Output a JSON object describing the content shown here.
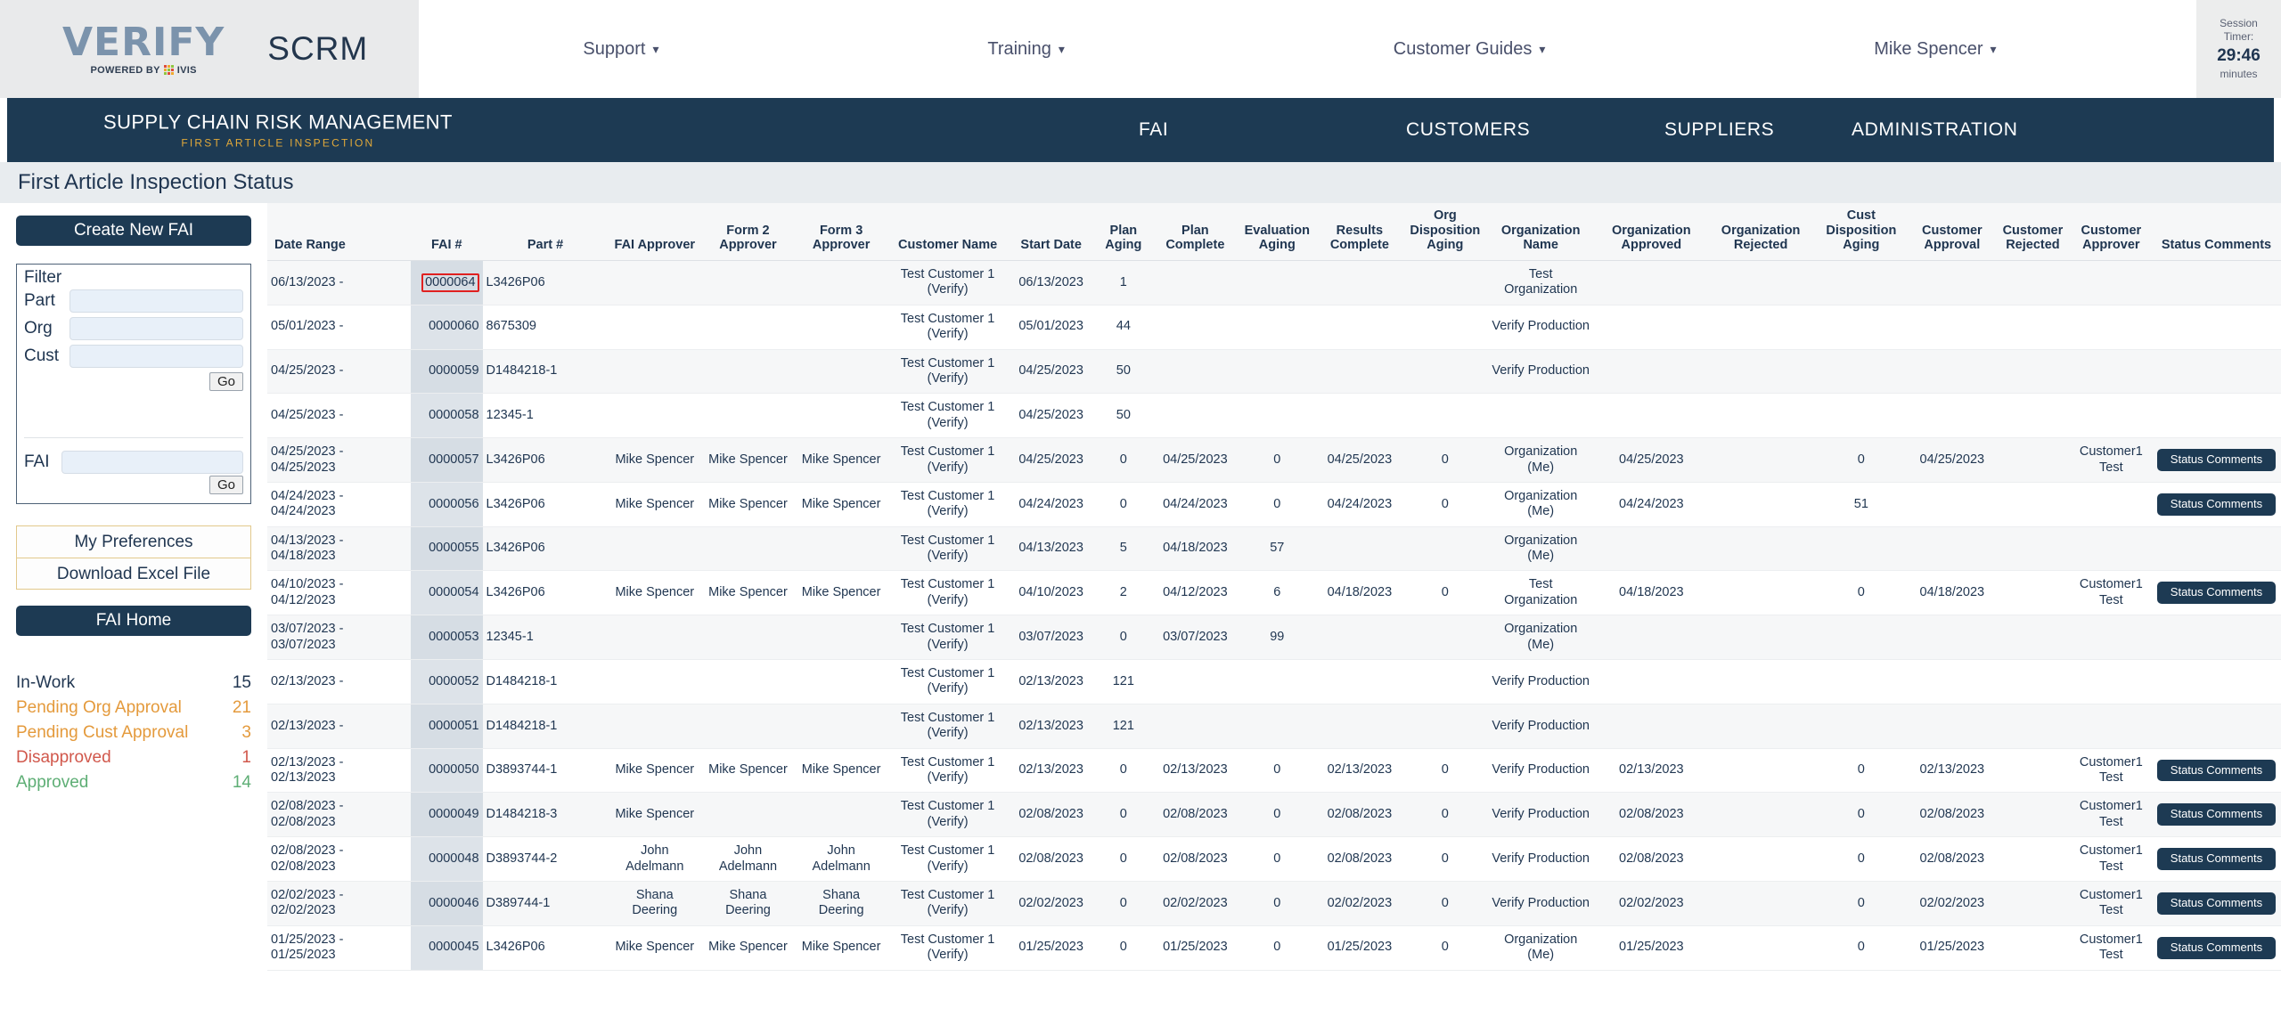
{
  "header": {
    "logo_word": "VERIFY",
    "logo_powered": "POWERED BY",
    "logo_brand": "IVIS",
    "app_short": "SCRM",
    "nav": [
      {
        "label": "Support",
        "caret": "chevron-down-icon"
      },
      {
        "label": "Training",
        "caret": "chevron-down-icon"
      },
      {
        "label": "Customer Guides",
        "caret": "chevron-down-icon"
      },
      {
        "label": "Mike Spencer",
        "caret": "chevron-down-icon"
      }
    ],
    "session": {
      "line1": "Session",
      "line2": "Timer:",
      "value": "29:46",
      "unit": "minutes"
    }
  },
  "navybar": {
    "brand_main": "SUPPLY CHAIN RISK MANAGEMENT",
    "brand_sub": "FIRST ARTICLE INSPECTION",
    "links": [
      "FAI",
      "CUSTOMERS",
      "SUPPLIERS",
      "ADMINISTRATION"
    ]
  },
  "page_title": "First Article Inspection Status",
  "sidebar": {
    "create_button": "Create New FAI",
    "filter_title": "Filter",
    "filter_fields": [
      {
        "label": "Part",
        "value": "",
        "placeholder": ""
      },
      {
        "label": "Org",
        "value": "",
        "placeholder": ""
      },
      {
        "label": "Cust",
        "value": "",
        "placeholder": ""
      }
    ],
    "go_label_1": "Go",
    "fai_label": "FAI",
    "fai_value": "",
    "go_label_2": "Go",
    "preferences": [
      "My Preferences",
      "Download Excel File"
    ],
    "home_button": "FAI Home",
    "status_counts": [
      {
        "label": "In-Work",
        "count": "15",
        "color": "#1f3550"
      },
      {
        "label": "Pending Org Approval",
        "count": "21",
        "color": "#e49a3c"
      },
      {
        "label": "Pending Cust Approval",
        "count": "3",
        "color": "#e49a3c"
      },
      {
        "label": "Disapproved",
        "count": "1",
        "color": "#d1584c"
      },
      {
        "label": "Approved",
        "count": "14",
        "color": "#5eae75"
      }
    ]
  },
  "table": {
    "columns": [
      "Date Range",
      "FAI #",
      "Part #",
      "FAI Approver",
      "Form 2 Approver",
      "Form 3 Approver",
      "Customer Name",
      "Start Date",
      "Plan Aging",
      "Plan Complete",
      "Evaluation Aging",
      "Results Complete",
      "Org Disposition Aging",
      "Organization Name",
      "Organization Approved",
      "Organization Rejected",
      "Cust Disposition Aging",
      "Customer Approval",
      "Customer Rejected",
      "Customer Approver",
      "Status Comments"
    ],
    "status_button_label": "Status Comments",
    "highlight_fai": "0000064",
    "rows": [
      {
        "date_range": "06/13/2023 -",
        "fai": "0000064",
        "part": "L3426P06",
        "fai_approver": "",
        "form2": "",
        "form3": "",
        "customer": "Test Customer 1 (Verify)",
        "start": "06/13/2023",
        "plan_aging": "1",
        "plan_complete": "",
        "eval_aging": "",
        "results_complete": "",
        "org_disp_aging": "",
        "org_name": "Test Organization",
        "org_approved": "",
        "org_rejected": "",
        "cust_disp_aging": "",
        "cust_approval": "",
        "cust_rejected": "",
        "cust_approver": "",
        "status": false
      },
      {
        "date_range": "05/01/2023 -",
        "fai": "0000060",
        "part": "8675309",
        "fai_approver": "",
        "form2": "",
        "form3": "",
        "customer": "Test Customer 1 (Verify)",
        "start": "05/01/2023",
        "plan_aging": "44",
        "plan_complete": "",
        "eval_aging": "",
        "results_complete": "",
        "org_disp_aging": "",
        "org_name": "Verify Production",
        "org_approved": "",
        "org_rejected": "",
        "cust_disp_aging": "",
        "cust_approval": "",
        "cust_rejected": "",
        "cust_approver": "",
        "status": false
      },
      {
        "date_range": "04/25/2023 -",
        "fai": "0000059",
        "part": "D1484218-1",
        "fai_approver": "",
        "form2": "",
        "form3": "",
        "customer": "Test Customer 1 (Verify)",
        "start": "04/25/2023",
        "plan_aging": "50",
        "plan_complete": "",
        "eval_aging": "",
        "results_complete": "",
        "org_disp_aging": "",
        "org_name": "Verify Production",
        "org_approved": "",
        "org_rejected": "",
        "cust_disp_aging": "",
        "cust_approval": "",
        "cust_rejected": "",
        "cust_approver": "",
        "status": false
      },
      {
        "date_range": "04/25/2023 -",
        "fai": "0000058",
        "part": "12345-1",
        "fai_approver": "",
        "form2": "",
        "form3": "",
        "customer": "Test Customer 1 (Verify)",
        "start": "04/25/2023",
        "plan_aging": "50",
        "plan_complete": "",
        "eval_aging": "",
        "results_complete": "",
        "org_disp_aging": "",
        "org_name": "",
        "org_approved": "",
        "org_rejected": "",
        "cust_disp_aging": "",
        "cust_approval": "",
        "cust_rejected": "",
        "cust_approver": "",
        "status": false
      },
      {
        "date_range": "04/25/2023 - 04/25/2023",
        "fai": "0000057",
        "part": "L3426P06",
        "fai_approver": "Mike Spencer",
        "form2": "Mike Spencer",
        "form3": "Mike Spencer",
        "customer": "Test Customer 1 (Verify)",
        "start": "04/25/2023",
        "plan_aging": "0",
        "plan_complete": "04/25/2023",
        "eval_aging": "0",
        "results_complete": "04/25/2023",
        "org_disp_aging": "0",
        "org_name": "Organization (Me)",
        "org_approved": "04/25/2023",
        "org_rejected": "",
        "cust_disp_aging": "0",
        "cust_approval": "04/25/2023",
        "cust_rejected": "",
        "cust_approver": "Customer1 Test",
        "status": true
      },
      {
        "date_range": "04/24/2023 - 04/24/2023",
        "fai": "0000056",
        "part": "L3426P06",
        "fai_approver": "Mike Spencer",
        "form2": "Mike Spencer",
        "form3": "Mike Spencer",
        "customer": "Test Customer 1 (Verify)",
        "start": "04/24/2023",
        "plan_aging": "0",
        "plan_complete": "04/24/2023",
        "eval_aging": "0",
        "results_complete": "04/24/2023",
        "org_disp_aging": "0",
        "org_name": "Organization (Me)",
        "org_approved": "04/24/2023",
        "org_rejected": "",
        "cust_disp_aging": "51",
        "cust_approval": "",
        "cust_rejected": "",
        "cust_approver": "",
        "status": true
      },
      {
        "date_range": "04/13/2023 - 04/18/2023",
        "fai": "0000055",
        "part": "L3426P06",
        "fai_approver": "",
        "form2": "",
        "form3": "",
        "customer": "Test Customer 1 (Verify)",
        "start": "04/13/2023",
        "plan_aging": "5",
        "plan_complete": "04/18/2023",
        "eval_aging": "57",
        "results_complete": "",
        "org_disp_aging": "",
        "org_name": "Organization (Me)",
        "org_approved": "",
        "org_rejected": "",
        "cust_disp_aging": "",
        "cust_approval": "",
        "cust_rejected": "",
        "cust_approver": "",
        "status": false
      },
      {
        "date_range": "04/10/2023 - 04/12/2023",
        "fai": "0000054",
        "part": "L3426P06",
        "fai_approver": "Mike Spencer",
        "form2": "Mike Spencer",
        "form3": "Mike Spencer",
        "customer": "Test Customer 1 (Verify)",
        "start": "04/10/2023",
        "plan_aging": "2",
        "plan_complete": "04/12/2023",
        "eval_aging": "6",
        "results_complete": "04/18/2023",
        "org_disp_aging": "0",
        "org_name": "Test Organization",
        "org_approved": "04/18/2023",
        "org_rejected": "",
        "cust_disp_aging": "0",
        "cust_approval": "04/18/2023",
        "cust_rejected": "",
        "cust_approver": "Customer1 Test",
        "status": true
      },
      {
        "date_range": "03/07/2023 - 03/07/2023",
        "fai": "0000053",
        "part": "12345-1",
        "fai_approver": "",
        "form2": "",
        "form3": "",
        "customer": "Test Customer 1 (Verify)",
        "start": "03/07/2023",
        "plan_aging": "0",
        "plan_complete": "03/07/2023",
        "eval_aging": "99",
        "results_complete": "",
        "org_disp_aging": "",
        "org_name": "Organization (Me)",
        "org_approved": "",
        "org_rejected": "",
        "cust_disp_aging": "",
        "cust_approval": "",
        "cust_rejected": "",
        "cust_approver": "",
        "status": false
      },
      {
        "date_range": "02/13/2023 -",
        "fai": "0000052",
        "part": "D1484218-1",
        "fai_approver": "",
        "form2": "",
        "form3": "",
        "customer": "Test Customer 1 (Verify)",
        "start": "02/13/2023",
        "plan_aging": "121",
        "plan_complete": "",
        "eval_aging": "",
        "results_complete": "",
        "org_disp_aging": "",
        "org_name": "Verify Production",
        "org_approved": "",
        "org_rejected": "",
        "cust_disp_aging": "",
        "cust_approval": "",
        "cust_rejected": "",
        "cust_approver": "",
        "status": false
      },
      {
        "date_range": "02/13/2023 -",
        "fai": "0000051",
        "part": "D1484218-1",
        "fai_approver": "",
        "form2": "",
        "form3": "",
        "customer": "Test Customer 1 (Verify)",
        "start": "02/13/2023",
        "plan_aging": "121",
        "plan_complete": "",
        "eval_aging": "",
        "results_complete": "",
        "org_disp_aging": "",
        "org_name": "Verify Production",
        "org_approved": "",
        "org_rejected": "",
        "cust_disp_aging": "",
        "cust_approval": "",
        "cust_rejected": "",
        "cust_approver": "",
        "status": false
      },
      {
        "date_range": "02/13/2023 - 02/13/2023",
        "fai": "0000050",
        "part": "D3893744-1",
        "fai_approver": "Mike Spencer",
        "form2": "Mike Spencer",
        "form3": "Mike Spencer",
        "customer": "Test Customer 1 (Verify)",
        "start": "02/13/2023",
        "plan_aging": "0",
        "plan_complete": "02/13/2023",
        "eval_aging": "0",
        "results_complete": "02/13/2023",
        "org_disp_aging": "0",
        "org_name": "Verify Production",
        "org_approved": "02/13/2023",
        "org_rejected": "",
        "cust_disp_aging": "0",
        "cust_approval": "02/13/2023",
        "cust_rejected": "",
        "cust_approver": "Customer1 Test",
        "status": true
      },
      {
        "date_range": "02/08/2023 - 02/08/2023",
        "fai": "0000049",
        "part": "D1484218-3",
        "fai_approver": "Mike Spencer",
        "form2": "",
        "form3": "",
        "customer": "Test Customer 1 (Verify)",
        "start": "02/08/2023",
        "plan_aging": "0",
        "plan_complete": "02/08/2023",
        "eval_aging": "0",
        "results_complete": "02/08/2023",
        "org_disp_aging": "0",
        "org_name": "Verify Production",
        "org_approved": "02/08/2023",
        "org_rejected": "",
        "cust_disp_aging": "0",
        "cust_approval": "02/08/2023",
        "cust_rejected": "",
        "cust_approver": "Customer1 Test",
        "status": true
      },
      {
        "date_range": "02/08/2023 - 02/08/2023",
        "fai": "0000048",
        "part": "D3893744-2",
        "fai_approver": "John Adelmann",
        "form2": "John Adelmann",
        "form3": "John Adelmann",
        "customer": "Test Customer 1 (Verify)",
        "start": "02/08/2023",
        "plan_aging": "0",
        "plan_complete": "02/08/2023",
        "eval_aging": "0",
        "results_complete": "02/08/2023",
        "org_disp_aging": "0",
        "org_name": "Verify Production",
        "org_approved": "02/08/2023",
        "org_rejected": "",
        "cust_disp_aging": "0",
        "cust_approval": "02/08/2023",
        "cust_rejected": "",
        "cust_approver": "Customer1 Test",
        "status": true
      },
      {
        "date_range": "02/02/2023 - 02/02/2023",
        "fai": "0000046",
        "part": "D389744-1",
        "fai_approver": "Shana Deering",
        "form2": "Shana Deering",
        "form3": "Shana Deering",
        "customer": "Test Customer 1 (Verify)",
        "start": "02/02/2023",
        "plan_aging": "0",
        "plan_complete": "02/02/2023",
        "eval_aging": "0",
        "results_complete": "02/02/2023",
        "org_disp_aging": "0",
        "org_name": "Verify Production",
        "org_approved": "02/02/2023",
        "org_rejected": "",
        "cust_disp_aging": "0",
        "cust_approval": "02/02/2023",
        "cust_rejected": "",
        "cust_approver": "Customer1 Test",
        "status": true
      },
      {
        "date_range": "01/25/2023 - 01/25/2023",
        "fai": "0000045",
        "part": "L3426P06",
        "fai_approver": "Mike Spencer",
        "form2": "Mike Spencer",
        "form3": "Mike Spencer",
        "customer": "Test Customer 1 (Verify)",
        "start": "01/25/2023",
        "plan_aging": "0",
        "plan_complete": "01/25/2023",
        "eval_aging": "0",
        "results_complete": "01/25/2023",
        "org_disp_aging": "0",
        "org_name": "Organization (Me)",
        "org_approved": "01/25/2023",
        "org_rejected": "",
        "cust_disp_aging": "0",
        "cust_approval": "01/25/2023",
        "cust_rejected": "",
        "cust_approver": "Customer1 Test",
        "status": true
      }
    ]
  }
}
